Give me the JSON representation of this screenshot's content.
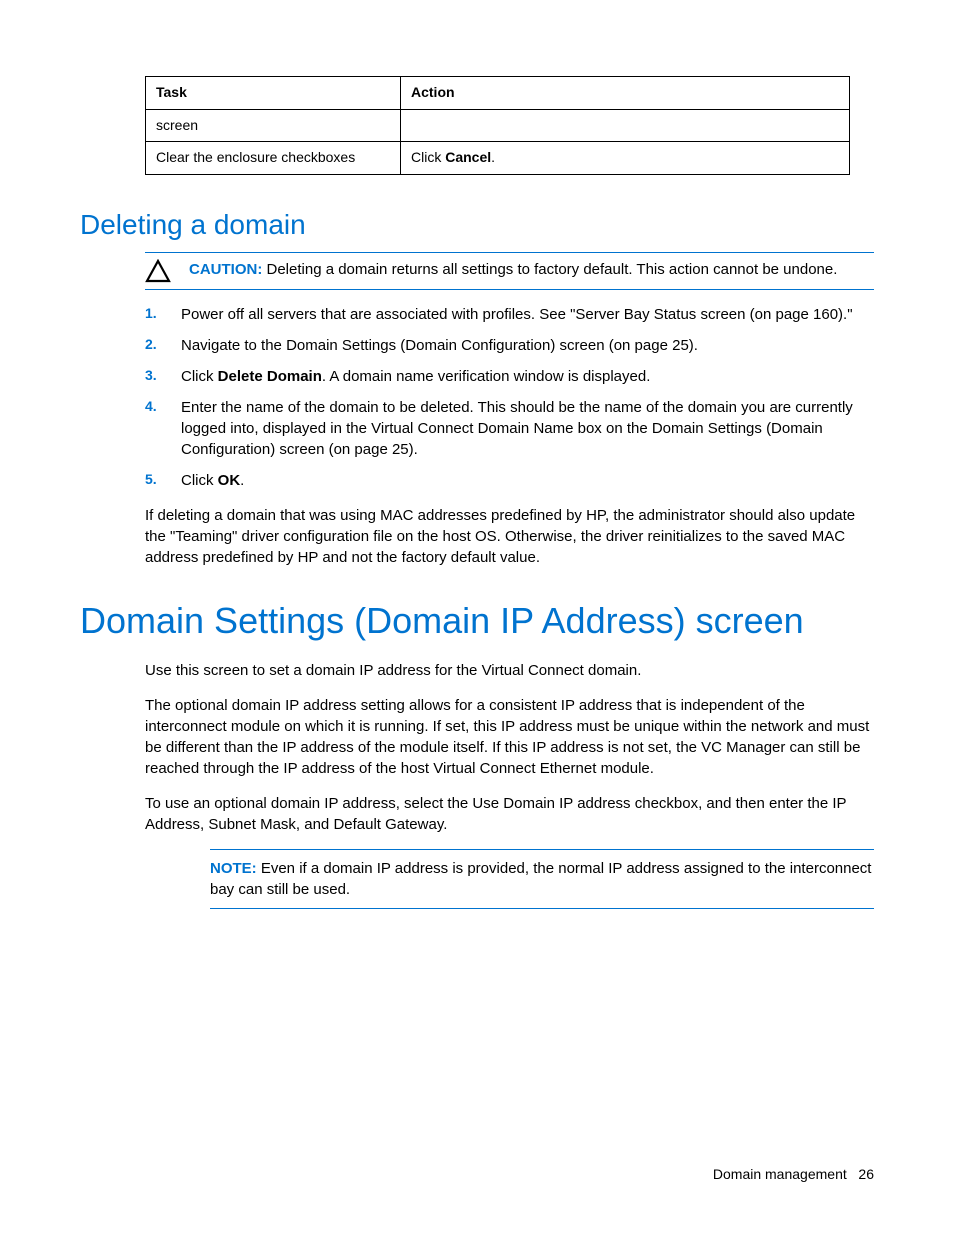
{
  "table": {
    "headers": {
      "task": "Task",
      "action": "Action"
    },
    "rows": [
      {
        "task": "screen",
        "action": ""
      },
      {
        "task": "Clear the enclosure checkboxes",
        "action_prefix": "Click ",
        "action_bold": "Cancel",
        "action_suffix": "."
      }
    ]
  },
  "section1": {
    "heading": "Deleting a domain",
    "caution_label": "CAUTION:",
    "caution_text": "  Deleting a domain returns all settings to factory default. This action cannot be undone.",
    "steps": [
      {
        "num": "1.",
        "text": "Power off all servers that are associated with profiles. See \"Server Bay Status screen (on page 160).\""
      },
      {
        "num": "2.",
        "text": "Navigate to the Domain Settings (Domain Configuration) screen (on page 25)."
      },
      {
        "num": "3.",
        "prefix": "Click ",
        "bold": "Delete Domain",
        "suffix": ". A domain name verification window is displayed."
      },
      {
        "num": "4.",
        "text": "Enter the name of the domain to be deleted. This should be the name of the domain you are currently logged into, displayed in the Virtual Connect Domain Name box on the Domain Settings (Domain Configuration) screen (on page 25)."
      },
      {
        "num": "5.",
        "prefix": "Click ",
        "bold": "OK",
        "suffix": "."
      }
    ],
    "followup": "If deleting a domain that was using MAC addresses predefined by HP, the administrator should also update the \"Teaming\" driver configuration file on the host OS. Otherwise, the driver reinitializes to the saved MAC address predefined by HP and not the factory default value."
  },
  "section2": {
    "heading": "Domain Settings (Domain IP Address) screen",
    "para1": "Use this screen to set a domain IP address for the Virtual Connect domain.",
    "para2": "The optional domain IP address setting allows for a consistent IP address that is independent of the interconnect module on which it is running. If set, this IP address must be unique within the network and must be different than the IP address of the module itself. If this IP address is not set, the VC Manager can still be reached through the IP address of the host Virtual Connect Ethernet module.",
    "para3": "To use an optional domain IP address, select the Use Domain IP address checkbox, and then enter the IP Address, Subnet Mask, and Default Gateway.",
    "note_label": "NOTE:",
    "note_text": "  Even if a domain IP address is provided, the normal IP address assigned to the interconnect bay can still be used."
  },
  "footer": {
    "section": "Domain management",
    "page": "26"
  }
}
